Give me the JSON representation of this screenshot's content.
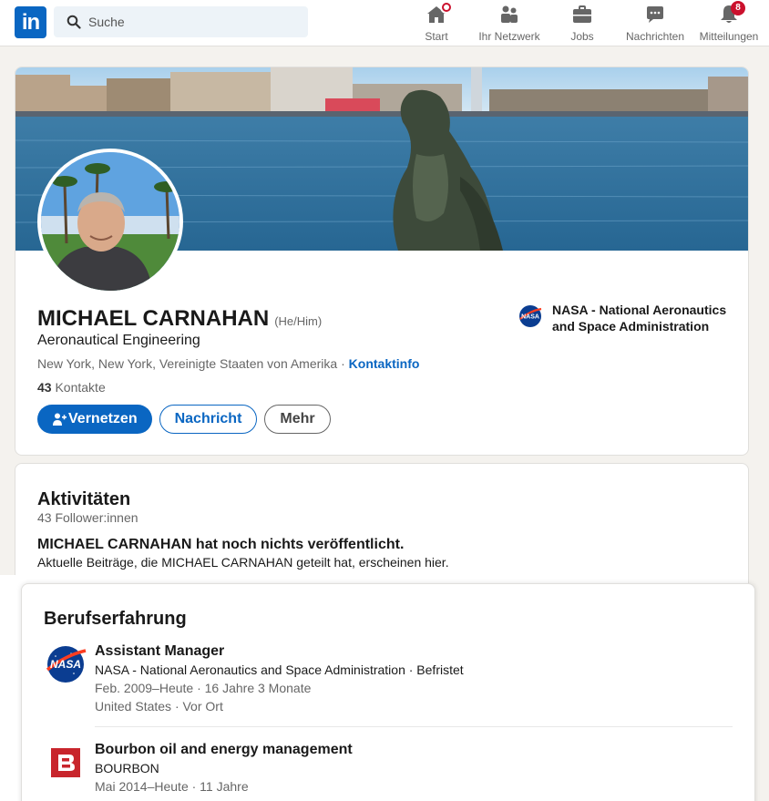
{
  "nav": {
    "logo_text": "in",
    "search_placeholder": "Suche",
    "items": [
      {
        "label": "Start",
        "icon": "home-icon",
        "badge": "dot"
      },
      {
        "label": "Ihr Netzwerk",
        "icon": "network-icon",
        "badge": ""
      },
      {
        "label": "Jobs",
        "icon": "briefcase-icon",
        "badge": ""
      },
      {
        "label": "Nachrichten",
        "icon": "messaging-icon",
        "badge": ""
      },
      {
        "label": "Mitteilungen",
        "icon": "bell-icon",
        "badge": "8"
      }
    ]
  },
  "profile": {
    "name": "MICHAEL CARNAHAN",
    "pronouns": "(He/Him)",
    "headline": "Aeronautical Engineering",
    "location": "New York, New York, Vereinigte Staaten von Amerika",
    "location_sep": " · ",
    "contact_info": "Kontaktinfo",
    "connections_count": "43",
    "connections_label": "Kontakte",
    "buttons": {
      "connect": "Vernetzen",
      "message": "Nachricht",
      "more": "Mehr"
    },
    "current_company": "NASA - National Aeronautics and Space Administration"
  },
  "activity": {
    "title": "Aktivitäten",
    "followers": "43 Follower:innen",
    "empty_title": "MICHAEL CARNAHAN hat noch nichts veröffentlicht.",
    "empty_sub": "Aktuelle Beiträge, die MICHAEL CARNAHAN geteilt hat, erscheinen hier."
  },
  "experience": {
    "title": "Berufserfahrung",
    "items": [
      {
        "role": "Assistant Manager",
        "company": "NASA - National Aeronautics and Space Administration · Befristet",
        "dates": "Feb. 2009–Heute · 16 Jahre 3 Monate",
        "place": "United States · Vor Ort",
        "logo": "nasa-logo"
      },
      {
        "role": "Bourbon oil and energy management",
        "company": "BOURBON",
        "dates": "Mai 2014–Heute · 11 Jahre",
        "place": "",
        "logo": "bourbon-logo"
      }
    ]
  },
  "colors": {
    "brand": "#0a66c2",
    "badge": "#cb112d",
    "background": "#f4f2ee"
  }
}
